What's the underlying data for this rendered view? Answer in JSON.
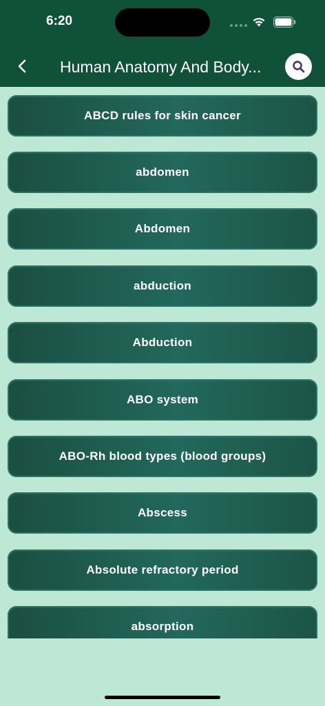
{
  "status_bar": {
    "time": "6:20"
  },
  "header": {
    "title": "Human Anatomy And Body...",
    "back_icon": "chevron-left-icon",
    "search_icon": "search-icon"
  },
  "colors": {
    "header_bg": "#10513a",
    "page_bg": "#bde8d6",
    "item_bg": "#1f5d4f",
    "search_icon": "#3b2a86"
  },
  "items": [
    {
      "label": "ABCD rules for skin cancer"
    },
    {
      "label": "abdomen"
    },
    {
      "label": "Abdomen"
    },
    {
      "label": "abduction"
    },
    {
      "label": "Abduction"
    },
    {
      "label": "ABO system"
    },
    {
      "label": "ABO-Rh blood types (blood groups)"
    },
    {
      "label": "Abscess"
    },
    {
      "label": "Absolute refractory period"
    },
    {
      "label": "absorption"
    }
  ]
}
